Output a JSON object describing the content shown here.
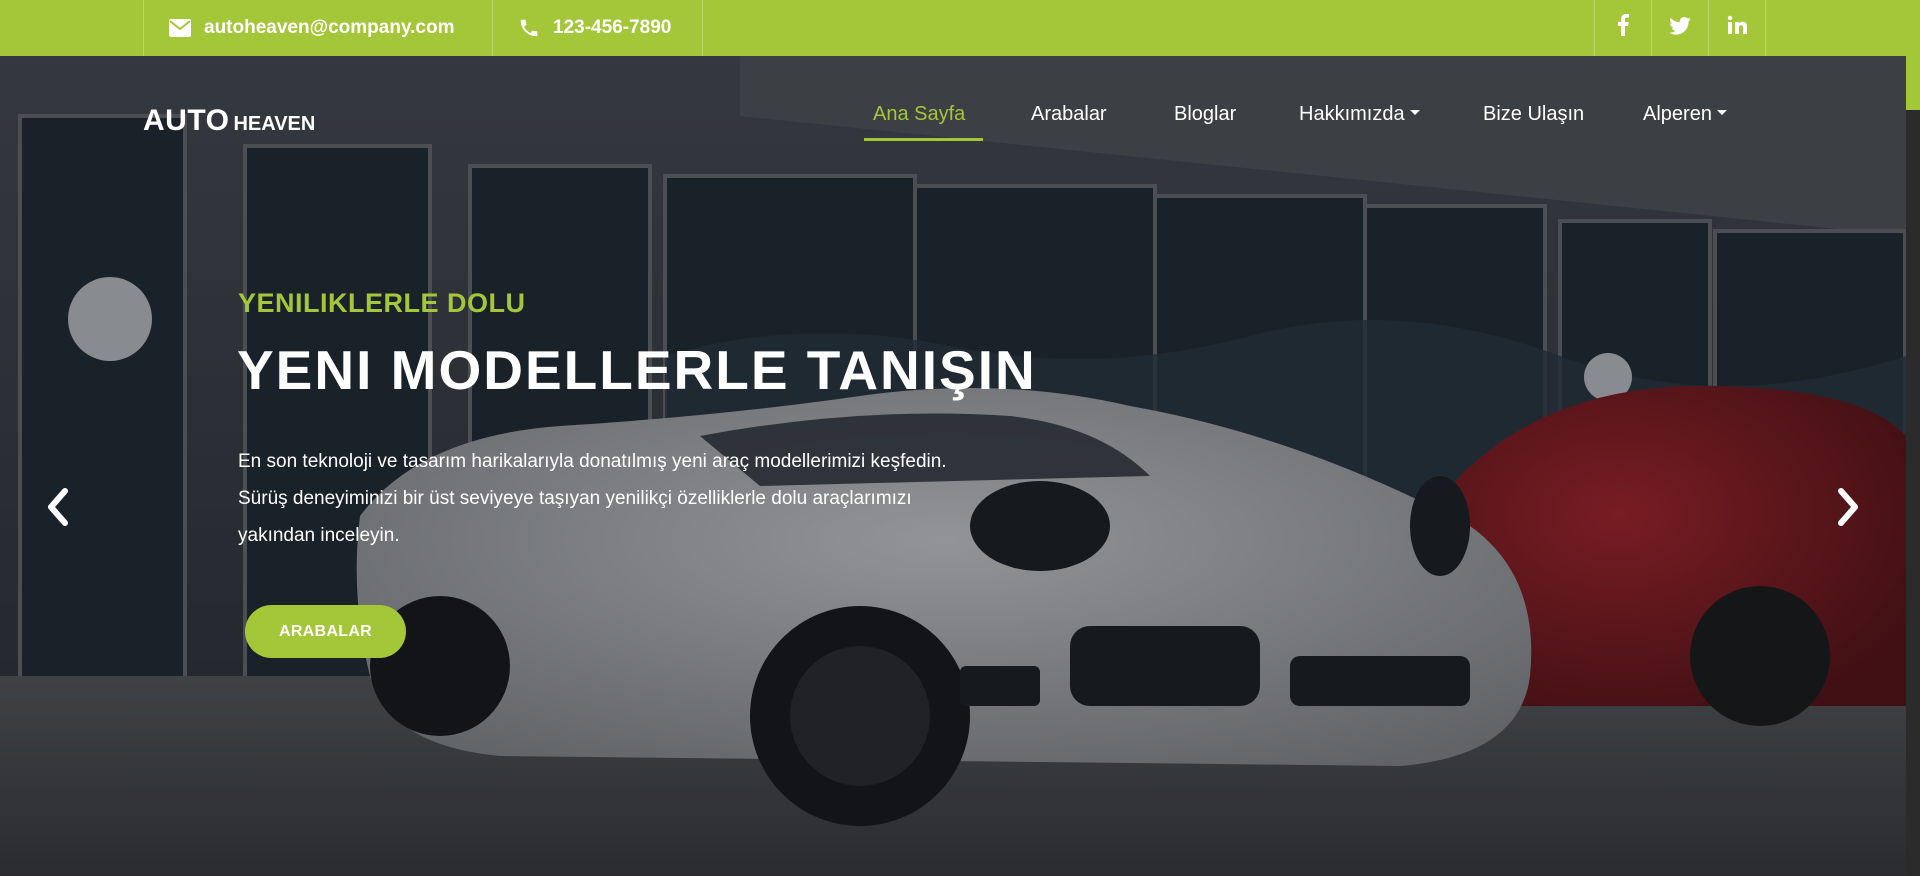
{
  "topbar": {
    "email": "autoheaven@company.com",
    "phone": "123-456-7890",
    "social": [
      {
        "name": "facebook",
        "glyph": "f"
      },
      {
        "name": "twitter",
        "glyph": "t"
      },
      {
        "name": "linkedin",
        "glyph": "in"
      }
    ]
  },
  "logo": {
    "part1": "AUTO",
    "part2": "HEAVEN"
  },
  "nav": {
    "items": [
      {
        "label": "Ana Sayfa",
        "active": true
      },
      {
        "label": "Arabalar"
      },
      {
        "label": "Bloglar"
      },
      {
        "label": "Hakkımızda",
        "dropdown": true
      },
      {
        "label": "Bize Ulaşın"
      },
      {
        "label": "Alperen",
        "dropdown": true
      }
    ]
  },
  "hero": {
    "kicker": "YENILIKLERLE DOLU",
    "title": "YENI MODELLERLE TANIŞIN",
    "description": "En son teknoloji ve tasarım harikalarıyla donatılmış yeni araç modellerimizi keşfedin. Sürüş deneyiminizi bir üst seviyeye taşıyan yenilikçi özelliklerle dolu araçlarımızı yakından inceleyin.",
    "cta_label": "ARABALAR"
  },
  "colors": {
    "accent": "#a4c639",
    "text": "#ffffff"
  },
  "icons": {
    "email": "envelope-icon",
    "phone": "phone-icon",
    "prev": "chevron-left-icon",
    "next": "chevron-right-icon"
  }
}
